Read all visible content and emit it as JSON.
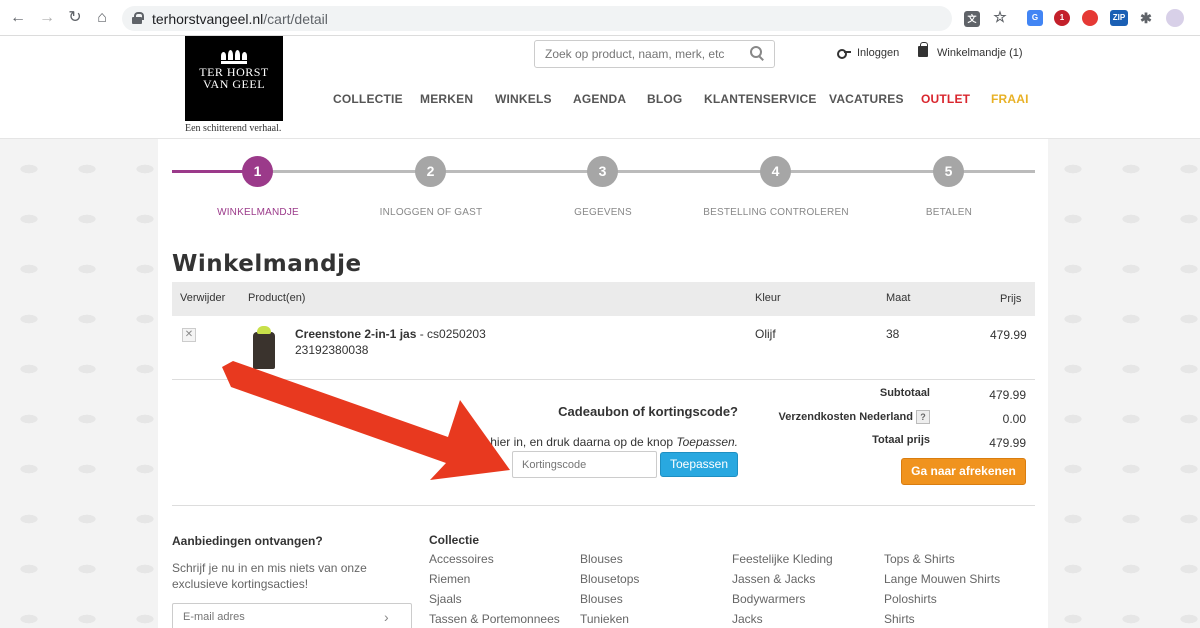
{
  "browser": {
    "url_host": "terhorstvangeel.nl",
    "url_path": "/cart/detail",
    "ext_abp_badge": "1",
    "ext_zip_label": "ZIP"
  },
  "header": {
    "logo_line1": "TER HORST",
    "logo_line2": "VAN GEEL",
    "tagline": "Een schitterend verhaal.",
    "search_placeholder": "Zoek op product, naam, merk, etc",
    "login_label": "Inloggen",
    "cart_label": "Winkelmandje (1)",
    "nav": [
      {
        "label": "COLLECTIE",
        "color": "#555555"
      },
      {
        "label": "MERKEN",
        "color": "#555555"
      },
      {
        "label": "WINKELS",
        "color": "#555555"
      },
      {
        "label": "AGENDA",
        "color": "#555555"
      },
      {
        "label": "BLOG",
        "color": "#555555"
      },
      {
        "label": "KLANTENSERVICE",
        "color": "#555555"
      },
      {
        "label": "VACATURES",
        "color": "#555555"
      },
      {
        "label": "OUTLET",
        "color": "#d9262e"
      },
      {
        "label": "FRAAI",
        "color": "#e8b126"
      }
    ]
  },
  "steps": [
    {
      "number": "1",
      "label": "WINKELMANDJE",
      "active": true
    },
    {
      "number": "2",
      "label": "INLOGGEN OF GAST",
      "active": false
    },
    {
      "number": "3",
      "label": "GEGEVENS",
      "active": false
    },
    {
      "number": "4",
      "label": "BESTELLING CONTROLEREN",
      "active": false
    },
    {
      "number": "5",
      "label": "BETALEN",
      "active": false
    }
  ],
  "cart": {
    "title": "Winkelmandje",
    "columns": [
      "Verwijder",
      "Product(en)",
      "Kleur",
      "Maat",
      "Prijs"
    ],
    "items": [
      {
        "remove": "✕",
        "name": "Creenstone 2-in-1 jas",
        "sku": " - cs0250203",
        "ean": "23192380038",
        "color": "Olijf",
        "size": "38",
        "price": "479.99"
      }
    ]
  },
  "voucher": {
    "title": "Cadeaubon of kortingscode?",
    "help_prefix": "hier in, en druk daarna op de knop ",
    "help_emph": "Toepassen.",
    "input_placeholder": "Kortingscode",
    "apply_label": "Toepassen"
  },
  "summary": {
    "subtotal_label": "Subtotaal",
    "subtotal_value": "479.99",
    "shipping_label": "Verzendkosten Nederland",
    "shipping_help": "?",
    "shipping_value": "0.00",
    "total_label": "Totaal prijs",
    "total_value": "479.99",
    "checkout_label": "Ga naar afrekenen"
  },
  "footer": {
    "newsletter_title": "Aanbiedingen ontvangen?",
    "newsletter_text": "Schrijf je nu in en mis niets van onze exclusieve kortingsacties!",
    "email_placeholder": "E-mail adres",
    "collection_title": "Collectie",
    "links_col1": [
      "Accessoires",
      "Riemen",
      "Sjaals",
      "Tassen & Portemonnees"
    ],
    "links_col2": [
      "Blouses",
      "Blousetops",
      "Blouses",
      "Tunieken"
    ],
    "links_col3": [
      "Feestelijke Kleding",
      "Jassen & Jacks",
      "Bodywarmers",
      "Jacks"
    ],
    "links_col4": [
      "Tops & Shirts",
      "Lange Mouwen Shirts",
      "Poloshirts",
      "Shirts"
    ]
  },
  "colors": {
    "accent_purple": "#9b3a8a",
    "apply_blue": "#29a8e0",
    "checkout_orange": "#f0931e",
    "annotation_red": "#e8391f"
  }
}
